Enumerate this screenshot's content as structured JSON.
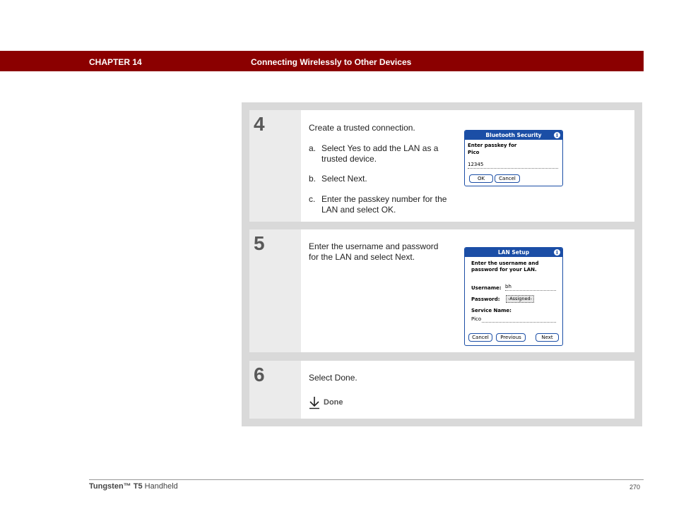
{
  "header": {
    "chapter": "CHAPTER 14",
    "title": "Connecting Wirelessly to Other Devices"
  },
  "steps": [
    {
      "number": "4",
      "intro": "Create a trusted connection.",
      "items": [
        {
          "label": "a.",
          "text": "Select Yes to add the LAN as a trusted device."
        },
        {
          "label": "b.",
          "text": "Select Next."
        },
        {
          "label": "c.",
          "text": "Enter the passkey number for the LAN and select OK."
        }
      ],
      "dialog": {
        "title": "Bluetooth Security",
        "prompt_line1": "Enter passkey for",
        "prompt_line2": "Pico",
        "passkey": "12345",
        "ok": "OK",
        "cancel": "Cancel"
      }
    },
    {
      "number": "5",
      "intro": "Enter the username and password for the LAN and select Next.",
      "dialog": {
        "title": "LAN Setup",
        "prompt_line1": "Enter the username and",
        "prompt_line2": "password for your LAN.",
        "username_label": "Username:",
        "username_value": "bh",
        "password_label": "Password:",
        "password_value": "-Assigned-",
        "service_label": "Service Name:",
        "service_value": "Pico",
        "cancel": "Cancel",
        "previous": "Previous",
        "next": "Next"
      }
    },
    {
      "number": "6",
      "intro": "Select Done.",
      "link": "Done"
    }
  ],
  "footer": {
    "product_brand": "Tungsten™",
    "product_model": "T5",
    "product_type": "Handheld",
    "page": "270"
  },
  "colors": {
    "header_bg": "#8b0000",
    "palm_blue": "#1b4ea6"
  }
}
